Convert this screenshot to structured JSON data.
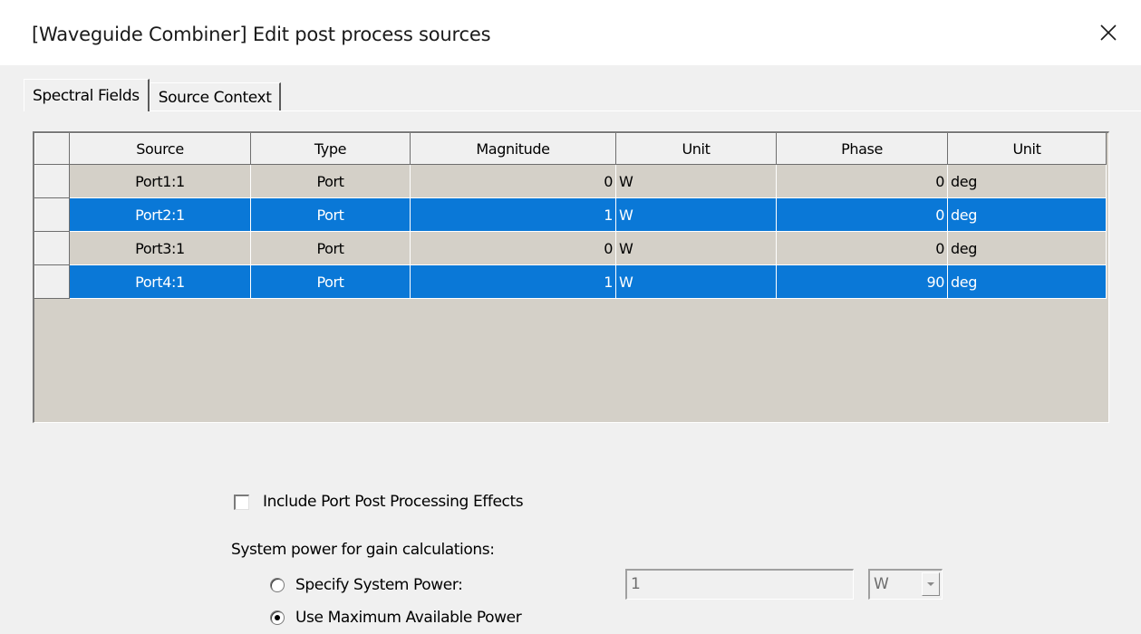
{
  "window": {
    "title": "[Waveguide Combiner]  Edit post process sources"
  },
  "tabs": [
    {
      "label": "Spectral Fields",
      "active": true
    },
    {
      "label": "Source Context",
      "active": false
    }
  ],
  "table": {
    "columns": [
      "Source",
      "Type",
      "Magnitude",
      "Unit",
      "Phase",
      "Unit"
    ],
    "rows": [
      {
        "source": "Port1:1",
        "type": "Port",
        "magnitude": "0",
        "mag_unit": "W",
        "phase": "0",
        "phase_unit": "deg",
        "selected": false
      },
      {
        "source": "Port2:1",
        "type": "Port",
        "magnitude": "1",
        "mag_unit": "W",
        "phase": "0",
        "phase_unit": "deg",
        "selected": true
      },
      {
        "source": "Port3:1",
        "type": "Port",
        "magnitude": "0",
        "mag_unit": "W",
        "phase": "0",
        "phase_unit": "deg",
        "selected": false
      },
      {
        "source": "Port4:1",
        "type": "Port",
        "magnitude": "1",
        "mag_unit": "W",
        "phase": "90",
        "phase_unit": "deg",
        "selected": true
      }
    ]
  },
  "options": {
    "include_port_effects_label": "Include Port Post Processing Effects",
    "include_port_effects_checked": false,
    "system_power_label": "System power for gain calculations:",
    "specify_power_label": "Specify System Power:",
    "specify_power_checked": false,
    "use_max_power_label": "Use Maximum Available Power",
    "use_max_power_checked": true,
    "power_value": "1",
    "power_unit": "W"
  },
  "icons": {
    "close": "close-icon",
    "dropdown": "chevron-down-icon"
  },
  "colors": {
    "selection": "#0a78d7",
    "grid_background": "#d4d0c8"
  }
}
